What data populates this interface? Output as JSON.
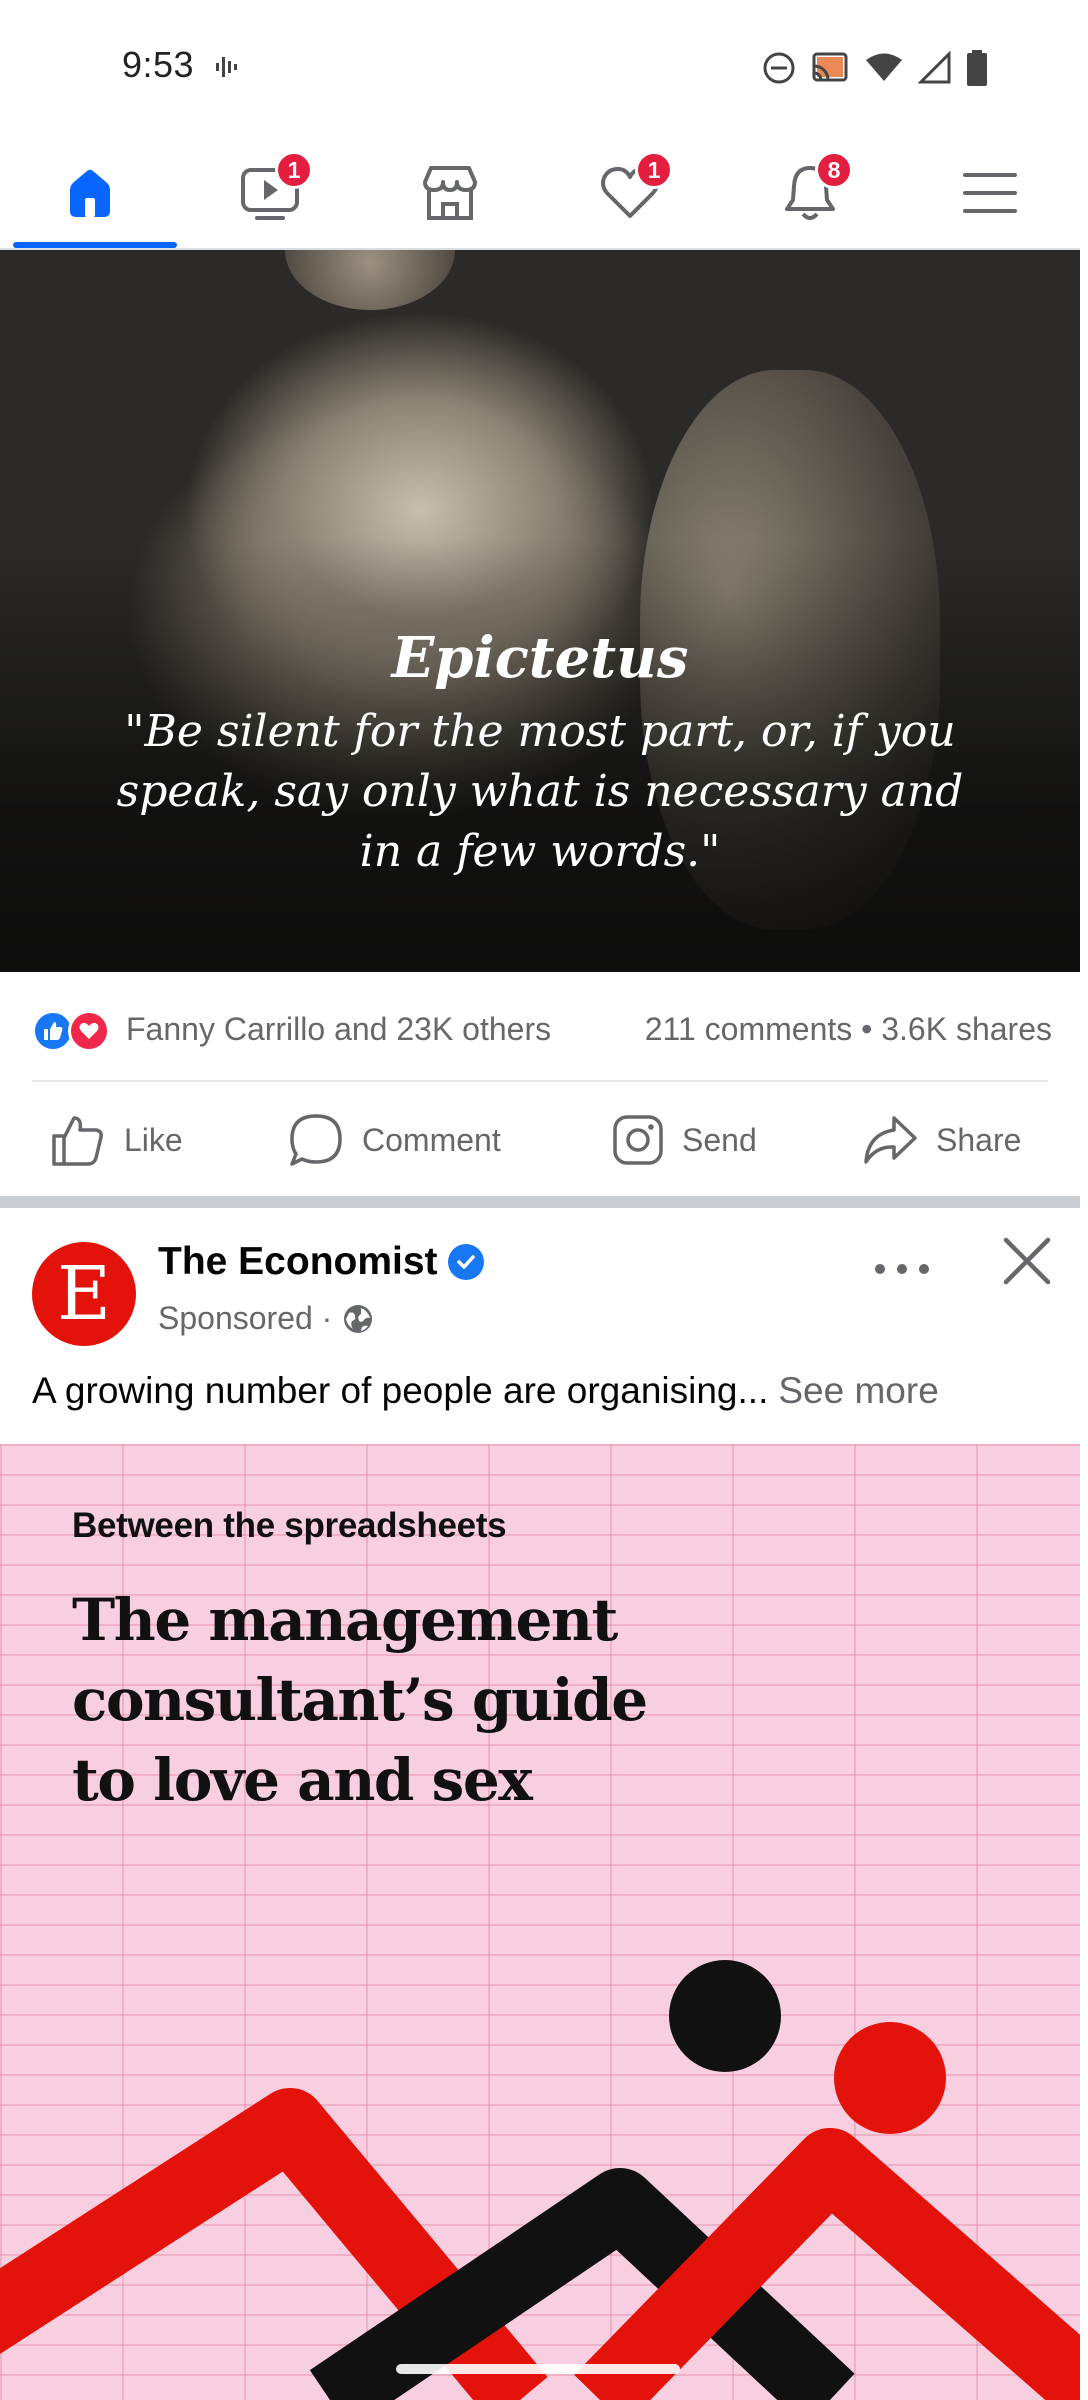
{
  "status_bar": {
    "time": "9:53"
  },
  "nav": {
    "tabs": [
      {
        "name": "home",
        "badge": null,
        "active": true
      },
      {
        "name": "video",
        "badge": "1"
      },
      {
        "name": "marketplace",
        "badge": null
      },
      {
        "name": "dating",
        "badge": "1"
      },
      {
        "name": "notifications",
        "badge": "8"
      },
      {
        "name": "menu",
        "badge": null
      }
    ],
    "accent_color": "#0866ff",
    "badge_color": "#e41e3f"
  },
  "post1": {
    "quote_author": "Epictetus",
    "quote_text": "\"Be silent for the most part, or, if you speak, say only what is necessary and in a few words.\"",
    "reactions_text": "Fanny Carrillo and 23K others",
    "stats_text": "211 comments • 3.6K shares",
    "actions": {
      "like": "Like",
      "comment": "Comment",
      "send": "Send",
      "share": "Share"
    }
  },
  "post2": {
    "avatar_letter": "E",
    "page_name": "The Economist",
    "sponsored": "Sponsored ·",
    "text": "A growing number of people are organising...",
    "see_more": "See more",
    "creative": {
      "kicker": "Between the spreadsheets",
      "headline": "The management consultant’s guide to love and sex"
    },
    "brand_color": "#e3120b"
  }
}
